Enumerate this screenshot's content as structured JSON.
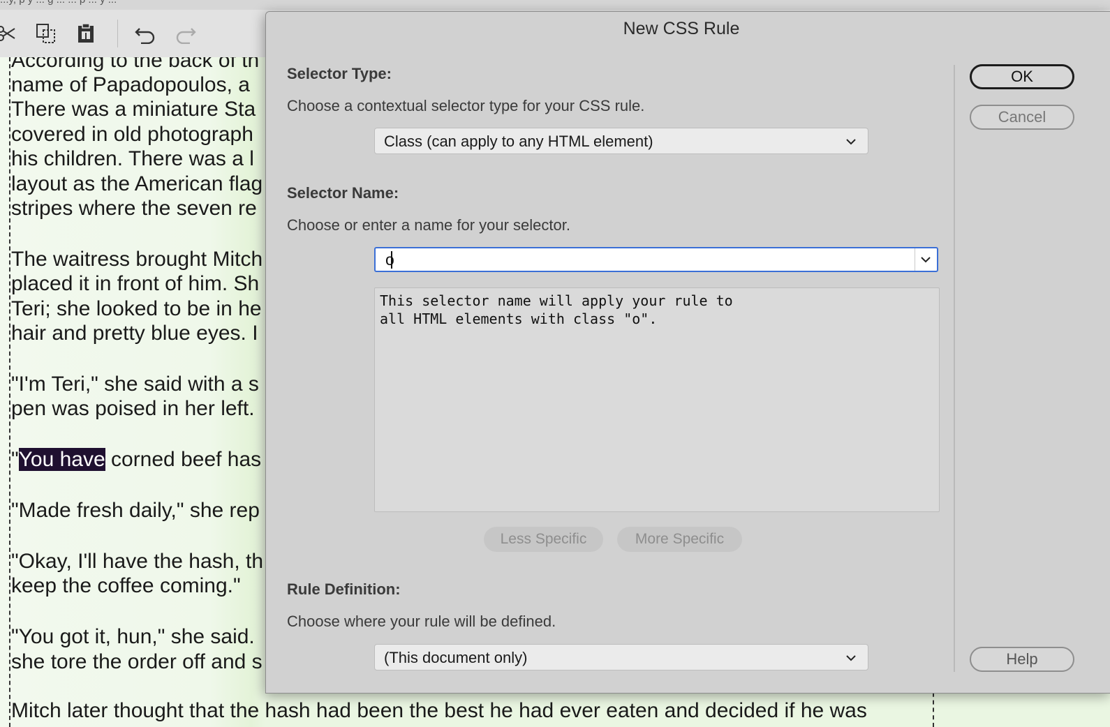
{
  "background": {
    "top_strip_text": "...y, p y ... g ... ... p ... y ...",
    "document_lines": [
      "According to the back of th",
      "name of Papadopoulos, a ",
      "There was a miniature Sta",
      "covered in old photograph",
      "his children. There was a l",
      "layout as the American flag",
      "stripes where the seven re",
      "The waitress brought Mitch",
      "placed it in front of him. Sh",
      "Teri; she looked to be in he",
      "hair and pretty blue eyes. I",
      "\"I'm Teri,\" she said with a s",
      "pen was poised in her left.",
      " corned beef has",
      "\"Made fresh daily,\" she rep",
      "\"Okay, I'll have the hash, th",
      "keep the coffee coming.\"",
      "\"You got it, hun,\" she said.",
      "she tore the order off and s",
      "Mitch later thought that the hash had been the best he had ever eaten and decided if he was"
    ],
    "highlight_prefix": "\"",
    "highlighted_text": "You have",
    "toolbar_icons": [
      "cut-icon",
      "copy-icon",
      "paste-icon",
      "undo-icon",
      "redo-icon"
    ]
  },
  "dialog": {
    "title": "New CSS Rule",
    "selector_type": {
      "label": "Selector Type:",
      "description": "Choose a contextual selector type for your CSS rule.",
      "selected": "Class (can apply to any HTML element)"
    },
    "selector_name": {
      "label": "Selector Name:",
      "description": "Choose or enter a name for your selector.",
      "value": "o",
      "info_line1": "This selector name will apply your rule to",
      "info_line2": "all HTML elements with class \"o\"."
    },
    "specificity": {
      "less": "Less Specific",
      "more": "More Specific"
    },
    "rule_definition": {
      "label": "Rule Definition:",
      "description": "Choose where your rule will be defined.",
      "selected": "(This document only)"
    },
    "buttons": {
      "ok": "OK",
      "cancel": "Cancel",
      "help": "Help"
    }
  }
}
